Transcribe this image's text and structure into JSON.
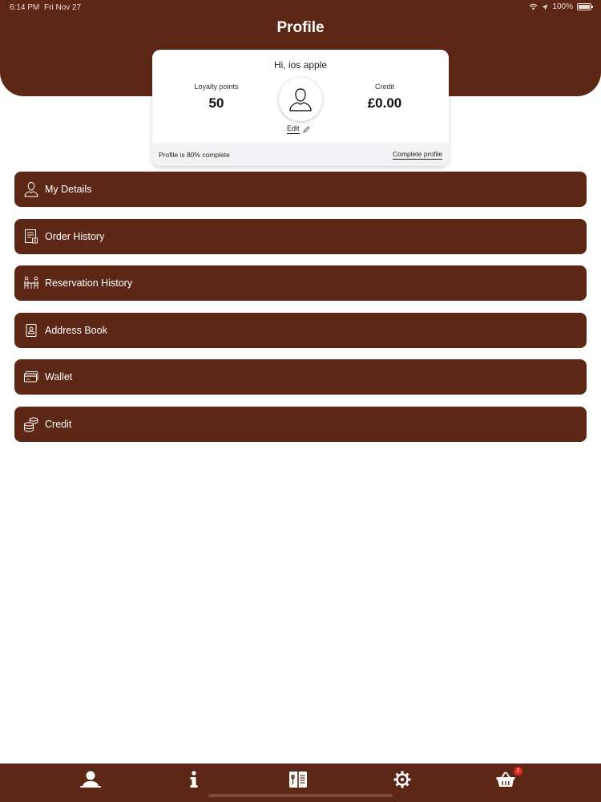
{
  "status_bar": {
    "time": "6:14 PM",
    "date": "Fri Nov 27",
    "battery": "100%"
  },
  "header": {
    "title": "Profile"
  },
  "profile_card": {
    "greeting": "Hi, ios apple",
    "loyalty_label": "Loyalty points",
    "loyalty_value": "50",
    "credit_label": "Credit",
    "credit_value": "£0.00",
    "edit_label": "Edit",
    "completion_text": "Profile is 80% complete",
    "complete_link": "Complete profile"
  },
  "menu": {
    "items": [
      {
        "label": "My Details",
        "icon": "user-icon"
      },
      {
        "label": "Order History",
        "icon": "receipt-icon"
      },
      {
        "label": "Reservation History",
        "icon": "table-reservation-icon"
      },
      {
        "label": "Address Book",
        "icon": "address-book-icon"
      },
      {
        "label": "Wallet",
        "icon": "card-icon"
      },
      {
        "label": "Credit",
        "icon": "coins-icon"
      }
    ]
  },
  "tab_bar": {
    "tabs": [
      {
        "name": "profile",
        "icon": "person-icon"
      },
      {
        "name": "info",
        "icon": "info-icon"
      },
      {
        "name": "menu",
        "icon": "menu-book-icon"
      },
      {
        "name": "settings",
        "icon": "gear-icon"
      },
      {
        "name": "basket",
        "icon": "basket-icon"
      }
    ],
    "basket_badge": "2"
  },
  "colors": {
    "brand": "#5c2715",
    "badge": "#e3241f"
  }
}
